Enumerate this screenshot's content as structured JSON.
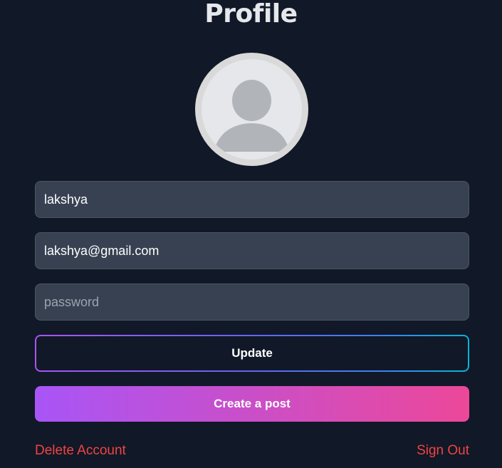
{
  "page": {
    "title": "Profile"
  },
  "profile": {
    "avatar_icon": "user-silhouette-icon",
    "username": "lakshya",
    "email": "lakshya@gmail.com",
    "password_value": "",
    "password_placeholder": "password"
  },
  "actions": {
    "update_label": "Update",
    "create_post_label": "Create a post",
    "delete_account_label": "Delete Account",
    "sign_out_label": "Sign Out"
  },
  "colors": {
    "background": "#111827",
    "input_bg": "#374151",
    "danger": "#ef4444",
    "gradient_start": "#a855f7",
    "gradient_end": "#ec4899"
  }
}
